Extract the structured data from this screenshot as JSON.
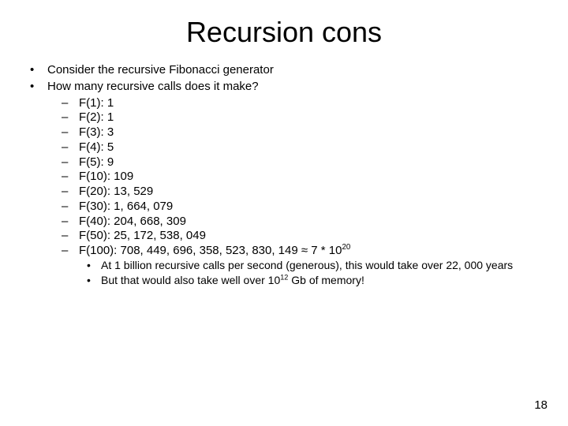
{
  "title": "Recursion cons",
  "top_bullets": [
    "Consider the recursive Fibonacci generator",
    "How many recursive calls does it make?"
  ],
  "fib_calls": [
    "F(1): 1",
    "F(2): 1",
    "F(3): 3",
    "F(4): 5",
    "F(5): 9",
    "F(10): 109",
    "F(20): 13, 529",
    "F(30): 1, 664, 079",
    "F(40): 204, 668, 309",
    "F(50): 25, 172, 538, 049"
  ],
  "fib_100_prefix": "F(100): 708, 449, 696, 358, 523, 830, 149 ≈ 7 * 10",
  "fib_100_exp": "20",
  "note1_prefix": "At 1 billion recursive calls per second (generous), this would take over 22, 000 years",
  "note2_prefix": "But that would also take well over 10",
  "note2_exp": "12",
  "note2_suffix": " Gb of memory!",
  "page_number": "18"
}
